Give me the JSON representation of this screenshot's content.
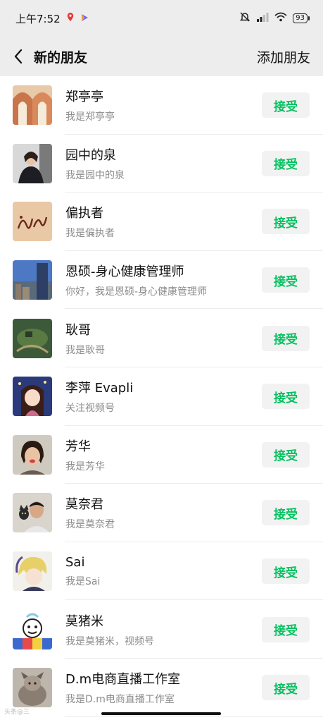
{
  "status": {
    "time": "上午7:52",
    "battery": "93"
  },
  "nav": {
    "title": "新的朋友",
    "action": "添加朋友"
  },
  "requests": [
    {
      "name": "郑亭亭",
      "message": "我是郑亭亭",
      "button": "接受",
      "avatar": "arch-building-avatar"
    },
    {
      "name": "园中的泉",
      "message": "我是园中的泉",
      "button": "接受",
      "avatar": "woman-portrait-avatar"
    },
    {
      "name": "偏执者",
      "message": "我是偏执者",
      "button": "接受",
      "avatar": "calligraphy-avatar"
    },
    {
      "name": "恩硕-身心健康管理师",
      "message": "你好，我是恩硕-身心健康管理师",
      "button": "接受",
      "avatar": "city-skyline-avatar"
    },
    {
      "name": "耿哥",
      "message": "我是耿哥",
      "button": "接受",
      "avatar": "aerial-landscape-avatar"
    },
    {
      "name": "李萍 Evapli",
      "message": "关注视频号",
      "button": "接受",
      "avatar": "anime-girl-avatar"
    },
    {
      "name": "芳华",
      "message": "我是芳华",
      "button": "接受",
      "avatar": "woman-selfie-avatar"
    },
    {
      "name": "莫奈君",
      "message": "我是莫奈君",
      "button": "接受",
      "avatar": "man-with-cat-avatar"
    },
    {
      "name": "Sai",
      "message": "我是Sai",
      "button": "接受",
      "avatar": "anime-boy-avatar"
    },
    {
      "name": "莫猪米",
      "message": "我是莫猪米，视频号",
      "button": "接受",
      "avatar": "cartoon-character-avatar"
    },
    {
      "name": "D.m电商直播工作室",
      "message": "我是D.m电商直播工作室",
      "button": "接受",
      "avatar": "dog-photo-avatar"
    }
  ],
  "watermark": "头条@三"
}
